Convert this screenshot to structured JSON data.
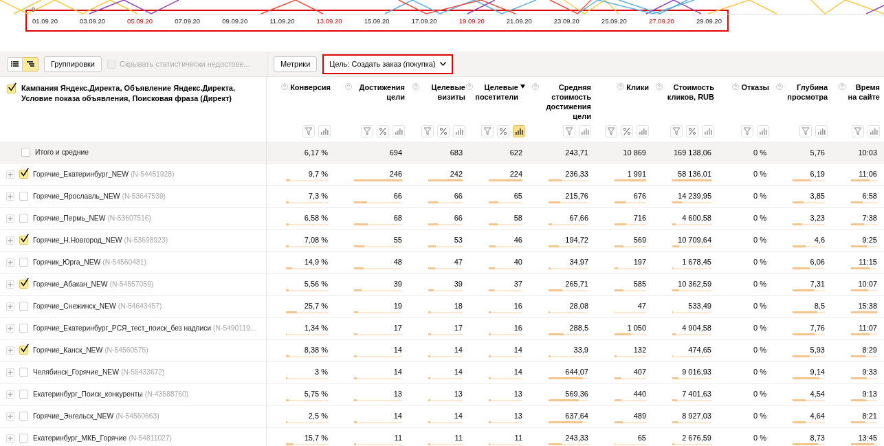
{
  "chart": {
    "axis_label": "0",
    "dates_highlighted": true,
    "dates": [
      {
        "label": "01.09.20",
        "weekend": false
      },
      {
        "label": "03.09.20",
        "weekend": false
      },
      {
        "label": "05.09.20",
        "weekend": true
      },
      {
        "label": "07.09.20",
        "weekend": false
      },
      {
        "label": "09.09.20",
        "weekend": false
      },
      {
        "label": "11.09.20",
        "weekend": false
      },
      {
        "label": "13.09.20",
        "weekend": true
      },
      {
        "label": "15.09.20",
        "weekend": false
      },
      {
        "label": "17.09.20",
        "weekend": false
      },
      {
        "label": "19.09.20",
        "weekend": true
      },
      {
        "label": "21.09.20",
        "weekend": false
      },
      {
        "label": "23.09.20",
        "weekend": false
      },
      {
        "label": "25.09.20",
        "weekend": false
      },
      {
        "label": "27.09.20",
        "weekend": true
      },
      {
        "label": "29.09.20",
        "weekend": false
      }
    ]
  },
  "toolbar": {
    "view_buttons": [
      {
        "kind": "list",
        "selected": false
      },
      {
        "kind": "tree",
        "selected": true
      }
    ],
    "grouping_button": "Группировки",
    "hide_checkbox": {
      "label": "Скрывать статистически недостове...",
      "checked": false,
      "disabled": true
    },
    "metrics_button": "Метрики",
    "goal_dropdown": {
      "label": "Цель: Создать заказ (покупка)",
      "highlighted": true
    }
  },
  "table": {
    "dimension_header": {
      "label": "Кампания Яндекс.Директа, Объявление Яндекс.Директа, Условие показа объявления, Поисковая фраза (Директ)",
      "checked": true
    },
    "columns": [
      {
        "label": "Конверсия",
        "sorted": false,
        "tools": [
          {
            "kind": "filter",
            "selected": false
          },
          {
            "kind": "chart",
            "selected": false
          }
        ]
      },
      {
        "label": "Достижения цели",
        "sorted": false,
        "tools": [
          {
            "kind": "filter",
            "selected": false
          },
          {
            "kind": "percent",
            "selected": false
          },
          {
            "kind": "chart",
            "selected": false
          }
        ]
      },
      {
        "label": "Целевые визиты",
        "sorted": false,
        "tools": [
          {
            "kind": "filter",
            "selected": false
          },
          {
            "kind": "percent",
            "selected": false
          },
          {
            "kind": "chart",
            "selected": false
          }
        ]
      },
      {
        "label": "Целевые посетители",
        "sorted": true,
        "tools": [
          {
            "kind": "filter",
            "selected": false
          },
          {
            "kind": "percent",
            "selected": false
          },
          {
            "kind": "chart",
            "selected": true
          }
        ]
      },
      {
        "label": "Средняя стоимость достижения цели",
        "sorted": false,
        "tools": [
          {
            "kind": "filter",
            "selected": false
          },
          {
            "kind": "chart",
            "selected": false
          }
        ]
      },
      {
        "label": "Клики",
        "sorted": false,
        "tools": [
          {
            "kind": "filter",
            "selected": false
          },
          {
            "kind": "percent",
            "selected": false
          },
          {
            "kind": "chart",
            "selected": false
          }
        ]
      },
      {
        "label": "Стоимость кликов, RUB",
        "sorted": false,
        "tools": [
          {
            "kind": "filter",
            "selected": false
          },
          {
            "kind": "percent",
            "selected": false
          },
          {
            "kind": "chart",
            "selected": false
          }
        ]
      },
      {
        "label": "Отказы",
        "sorted": false,
        "tools": [
          {
            "kind": "filter",
            "selected": false
          },
          {
            "kind": "chart",
            "selected": false
          }
        ]
      },
      {
        "label": "Глубина просмотра",
        "sorted": false,
        "tools": [
          {
            "kind": "filter",
            "selected": false
          },
          {
            "kind": "chart",
            "selected": false
          }
        ]
      },
      {
        "label": "Время на сайте",
        "sorted": false,
        "tools": [
          {
            "kind": "filter",
            "selected": false
          },
          {
            "kind": "chart",
            "selected": false
          }
        ]
      }
    ],
    "total": {
      "label": "Итого и средние",
      "checked": false,
      "cells": [
        "6,17 %",
        "694",
        "683",
        "622",
        "243,71",
        "10 869",
        "169 138,06",
        "0 %",
        "5,76",
        "10:03"
      ]
    },
    "rows": [
      {
        "name": "Горячие_Екатеринбург_NEW",
        "id": "(N-54451928)",
        "checked": true,
        "cells": [
          {
            "text": "9,7 %",
            "level": 0.1
          },
          {
            "text": "246",
            "level": 1
          },
          {
            "text": "242",
            "level": 1
          },
          {
            "text": "224",
            "level": 1
          },
          {
            "text": "236,33",
            "level": 0.32
          },
          {
            "text": "1 991",
            "level": 1
          },
          {
            "text": "58 136,01",
            "level": 1
          },
          {
            "text": "0 %"
          },
          {
            "text": "6,19",
            "level": 0.55
          },
          {
            "text": "11:06",
            "level": 0.71
          }
        ]
      },
      {
        "name": "Горячие_Ярославль_NEW",
        "id": "(N-53647539)",
        "checked": false,
        "cells": [
          {
            "text": "7,3 %",
            "level": 0.07
          },
          {
            "text": "66",
            "level": 0.27
          },
          {
            "text": "66",
            "level": 0.27
          },
          {
            "text": "65",
            "level": 0.29
          },
          {
            "text": "215,76",
            "level": 0.29
          },
          {
            "text": "676",
            "level": 0.34
          },
          {
            "text": "14 239,95",
            "level": 0.24
          },
          {
            "text": "0 %"
          },
          {
            "text": "3,85",
            "level": 0.34
          },
          {
            "text": "6:58",
            "level": 0.44
          }
        ]
      },
      {
        "name": "Горячие_Пермь_NEW",
        "id": "(N-53607516)",
        "checked": false,
        "cells": [
          {
            "text": "6,58 %",
            "level": 0.07
          },
          {
            "text": "68",
            "level": 0.28
          },
          {
            "text": "66",
            "level": 0.27
          },
          {
            "text": "58",
            "level": 0.26
          },
          {
            "text": "67,66",
            "level": 0.09
          },
          {
            "text": "716",
            "level": 0.36
          },
          {
            "text": "4 600,58",
            "level": 0.08
          },
          {
            "text": "0 %"
          },
          {
            "text": "3,23",
            "level": 0.29
          },
          {
            "text": "7:38",
            "level": 0.49
          }
        ]
      },
      {
        "name": "Горячие_Н.Новгород_NEW",
        "id": "(N-53698923)",
        "checked": true,
        "cells": [
          {
            "text": "7,08 %",
            "level": 0.07
          },
          {
            "text": "55",
            "level": 0.22
          },
          {
            "text": "53",
            "level": 0.22
          },
          {
            "text": "46",
            "level": 0.21
          },
          {
            "text": "194,72",
            "level": 0.26
          },
          {
            "text": "569",
            "level": 0.29
          },
          {
            "text": "10 709,64",
            "level": 0.18
          },
          {
            "text": "0 %"
          },
          {
            "text": "4,6",
            "level": 0.41
          },
          {
            "text": "9:25",
            "level": 0.6
          }
        ]
      },
      {
        "name": "Горячик_Юрга_NEW",
        "id": "(N-54560481)",
        "checked": false,
        "cells": [
          {
            "text": "14,9 %",
            "level": 0.15
          },
          {
            "text": "48",
            "level": 0.2
          },
          {
            "text": "47",
            "level": 0.19
          },
          {
            "text": "40",
            "level": 0.18
          },
          {
            "text": "34,97",
            "level": 0.05
          },
          {
            "text": "197",
            "level": 0.1
          },
          {
            "text": "1 678,45",
            "level": 0.03
          },
          {
            "text": "0 %"
          },
          {
            "text": "6,06",
            "level": 0.54
          },
          {
            "text": "11:15",
            "level": 0.72
          }
        ]
      },
      {
        "name": "Горячие_Абакан_NEW",
        "id": "(N-54557059)",
        "checked": true,
        "cells": [
          {
            "text": "5,56 %",
            "level": 0.06
          },
          {
            "text": "39",
            "level": 0.16
          },
          {
            "text": "39",
            "level": 0.16
          },
          {
            "text": "37",
            "level": 0.17
          },
          {
            "text": "265,71",
            "level": 0.35
          },
          {
            "text": "585",
            "level": 0.29
          },
          {
            "text": "10 362,59",
            "level": 0.18
          },
          {
            "text": "0 %"
          },
          {
            "text": "7,31",
            "level": 0.65
          },
          {
            "text": "10:07",
            "level": 0.65
          }
        ]
      },
      {
        "name": "Горячие_Снежинск_NEW",
        "id": "(N-54643457)",
        "checked": false,
        "cells": [
          {
            "text": "25,7 %",
            "level": 0.26
          },
          {
            "text": "19",
            "level": 0.08
          },
          {
            "text": "18",
            "level": 0.07
          },
          {
            "text": "16",
            "level": 0.07
          },
          {
            "text": "28,08",
            "level": 0.04
          },
          {
            "text": "47",
            "level": 0.02
          },
          {
            "text": "533,49",
            "level": 0.01
          },
          {
            "text": "0 %"
          },
          {
            "text": "8,5",
            "level": 0.76
          },
          {
            "text": "15:38",
            "level": 1
          }
        ]
      },
      {
        "name": "Горячие_Екатеринбург_РСЯ_тест_поиск_без надписи",
        "id": "(N-5490119...",
        "checked": false,
        "cells": [
          {
            "text": "1,34 %",
            "level": 0.01
          },
          {
            "text": "17",
            "level": 0.07
          },
          {
            "text": "17",
            "level": 0.07
          },
          {
            "text": "16",
            "level": 0.07
          },
          {
            "text": "288,5",
            "level": 0.38
          },
          {
            "text": "1 050",
            "level": 0.53
          },
          {
            "text": "4 904,58",
            "level": 0.08
          },
          {
            "text": "0 %"
          },
          {
            "text": "7,76",
            "level": 0.69
          },
          {
            "text": "11:07",
            "level": 0.71
          }
        ]
      },
      {
        "name": "Горячие_Канск_NEW",
        "id": "(N-54560575)",
        "checked": true,
        "cells": [
          {
            "text": "8,38 %",
            "level": 0.08
          },
          {
            "text": "14",
            "level": 0.06
          },
          {
            "text": "14",
            "level": 0.06
          },
          {
            "text": "14",
            "level": 0.06
          },
          {
            "text": "33,9",
            "level": 0.05
          },
          {
            "text": "132",
            "level": 0.07
          },
          {
            "text": "474,65",
            "level": 0.01
          },
          {
            "text": "0 %"
          },
          {
            "text": "5,93",
            "level": 0.53
          },
          {
            "text": "8:29",
            "level": 0.54
          }
        ]
      },
      {
        "name": "Челябинск_Горячие_NEW",
        "id": "(N-55433672)",
        "checked": false,
        "cells": [
          {
            "text": "3 %",
            "level": 0.03
          },
          {
            "text": "14",
            "level": 0.06
          },
          {
            "text": "14",
            "level": 0.06
          },
          {
            "text": "14",
            "level": 0.06
          },
          {
            "text": "644,07",
            "level": 0.86
          },
          {
            "text": "407",
            "level": 0.2
          },
          {
            "text": "9 016,93",
            "level": 0.16
          },
          {
            "text": "0 %"
          },
          {
            "text": "9,14",
            "level": 0.82
          },
          {
            "text": "9:33",
            "level": 0.61
          }
        ]
      },
      {
        "name": "Екатеринбург_Поиск_конкуренты",
        "id": "(N-43588760)",
        "checked": false,
        "cells": [
          {
            "text": "5,75 %",
            "level": 0.06
          },
          {
            "text": "13",
            "level": 0.05
          },
          {
            "text": "13",
            "level": 0.05
          },
          {
            "text": "13",
            "level": 0.06
          },
          {
            "text": "569,36",
            "level": 0.76
          },
          {
            "text": "440",
            "level": 0.22
          },
          {
            "text": "7 401,63",
            "level": 0.13
          },
          {
            "text": "0 %"
          },
          {
            "text": "4,54",
            "level": 0.41
          },
          {
            "text": "9:13",
            "level": 0.59
          }
        ]
      },
      {
        "name": "Горячие_Энгельск_NEW",
        "id": "(N-54560663)",
        "checked": false,
        "cells": [
          {
            "text": "2,5 %",
            "level": 0.03
          },
          {
            "text": "14",
            "level": 0.06
          },
          {
            "text": "14",
            "level": 0.06
          },
          {
            "text": "13",
            "level": 0.06
          },
          {
            "text": "637,64",
            "level": 0.85
          },
          {
            "text": "489",
            "level": 0.25
          },
          {
            "text": "8 927,03",
            "level": 0.15
          },
          {
            "text": "0 %"
          },
          {
            "text": "4,64",
            "level": 0.41
          },
          {
            "text": "8:21",
            "level": 0.53
          }
        ]
      },
      {
        "name": "Екатеринбург_МКБ_Горячие",
        "id": "(N-54811027)",
        "checked": false,
        "cells": [
          {
            "text": "15,7 %",
            "level": 0.16
          },
          {
            "text": "11",
            "level": 0.04
          },
          {
            "text": "11",
            "level": 0.05
          },
          {
            "text": "11",
            "level": 0.05
          },
          {
            "text": "243,33",
            "level": 0.32
          },
          {
            "text": "65",
            "level": 0.03
          },
          {
            "text": "2 676,59",
            "level": 0.05
          },
          {
            "text": "0 %"
          },
          {
            "text": "8,73",
            "level": 0.78
          },
          {
            "text": "13:45",
            "level": 0.88
          }
        ]
      }
    ]
  }
}
